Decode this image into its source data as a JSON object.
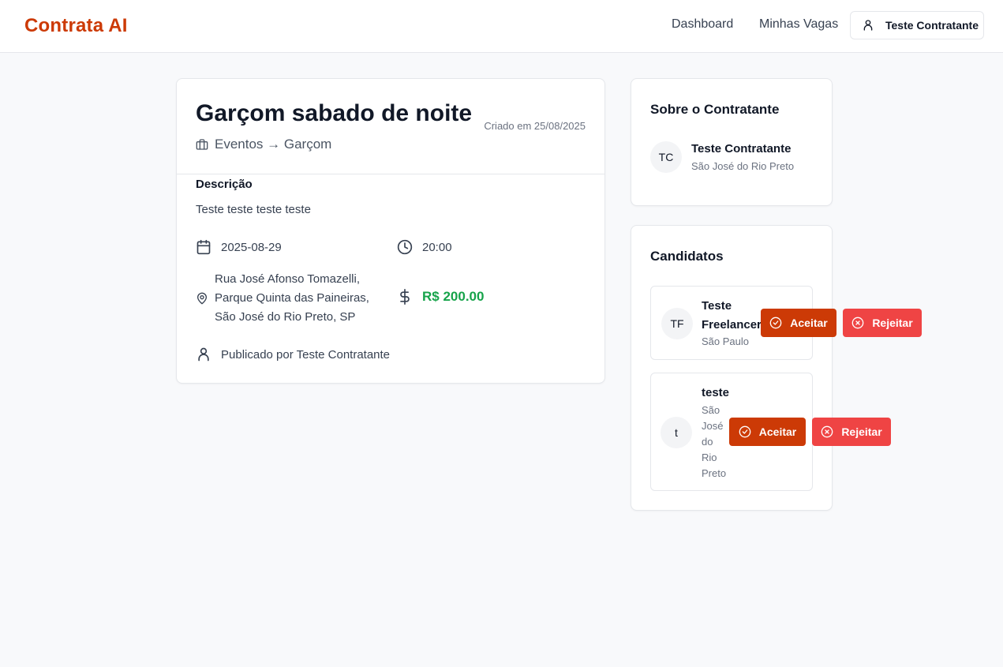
{
  "header": {
    "brand": "Contrata AI",
    "nav": {
      "dashboard": "Dashboard",
      "vagas": "Minhas Vagas"
    },
    "user": "Teste Contratante"
  },
  "job": {
    "title": "Garçom sabado de noite",
    "created": "Criado em 25/08/2025",
    "category": "Eventos → Garçom",
    "description_label": "Descrição",
    "description": "Teste teste teste teste",
    "date": "2025-08-29",
    "time": "20:00",
    "address": [
      "Rua José Afonso Tomazelli,",
      "Parque Quinta das Paineiras,",
      "São José do Rio Preto, SP"
    ],
    "price": "R$ 200.00",
    "publisher": "Publicado por Teste Contratante"
  },
  "about": {
    "title": "Sobre o Contratante",
    "initials": "TC",
    "name": "Teste Contratante",
    "city": "São José do Rio Preto"
  },
  "candidates": {
    "title": "Candidatos",
    "accept_label": "Aceitar",
    "reject_label": "Rejeitar",
    "items": [
      {
        "initials": "TF",
        "name_lines": [
          "Teste",
          "Freelancer"
        ],
        "city": "São Paulo"
      },
      {
        "initials": "t",
        "name": "teste",
        "city_lines": [
          "São",
          "José",
          "do",
          "Rio",
          "Preto"
        ]
      }
    ]
  },
  "colors": {
    "brand": "#cc3a06",
    "reject": "#ef4444",
    "price": "#16a34a"
  },
  "icons": [
    "user-icon",
    "briefcase-icon",
    "calendar-icon",
    "clock-icon",
    "map-pin-icon",
    "dollar-icon",
    "check-circle-icon",
    "x-circle-icon"
  ]
}
